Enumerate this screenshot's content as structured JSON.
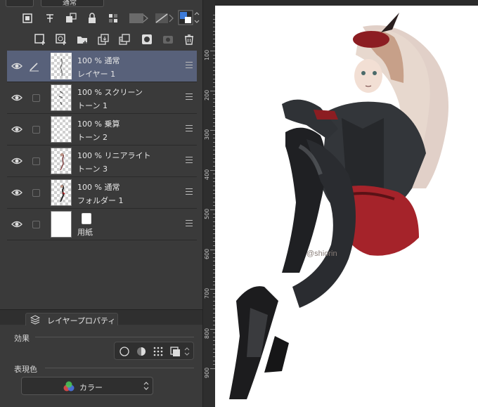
{
  "toolbar": {
    "blend_mode_dropdown": "通常"
  },
  "layers": [
    {
      "opacity": "100 %",
      "blend": "通常",
      "name": "レイヤー 1",
      "selected": true,
      "editing": true,
      "thumb": "transparent"
    },
    {
      "opacity": "100 %",
      "blend": "スクリーン",
      "name": "トーン 1",
      "selected": false,
      "editing": false,
      "thumb": "transparent"
    },
    {
      "opacity": "100 %",
      "blend": "乗算",
      "name": "トーン 2",
      "selected": false,
      "editing": false,
      "thumb": "transparent"
    },
    {
      "opacity": "100 %",
      "blend": "リニアライト",
      "name": "トーン 3",
      "selected": false,
      "editing": false,
      "thumb": "transparent"
    },
    {
      "opacity": "100 %",
      "blend": "通常",
      "name": "フォルダー 1",
      "selected": false,
      "editing": false,
      "thumb": "transparent"
    },
    {
      "opacity": "",
      "blend": "",
      "name": "用紙",
      "selected": false,
      "editing": false,
      "thumb": "white"
    }
  ],
  "properties": {
    "tab_label": "レイヤープロパティ",
    "effect_label": "効果",
    "expression_color_label": "表現色",
    "color_mode": "カラー"
  },
  "ruler": {
    "labels": [
      "100",
      "200",
      "300",
      "400",
      "500",
      "600",
      "700",
      "800",
      "900"
    ]
  },
  "canvas": {
    "signature": "@shiorin"
  },
  "colors": {
    "panel_bg": "#3a3a3a",
    "selected_layer": "#58617a",
    "canvas_bg": "#ffffff",
    "accent_blue": "#3d7bd9"
  }
}
